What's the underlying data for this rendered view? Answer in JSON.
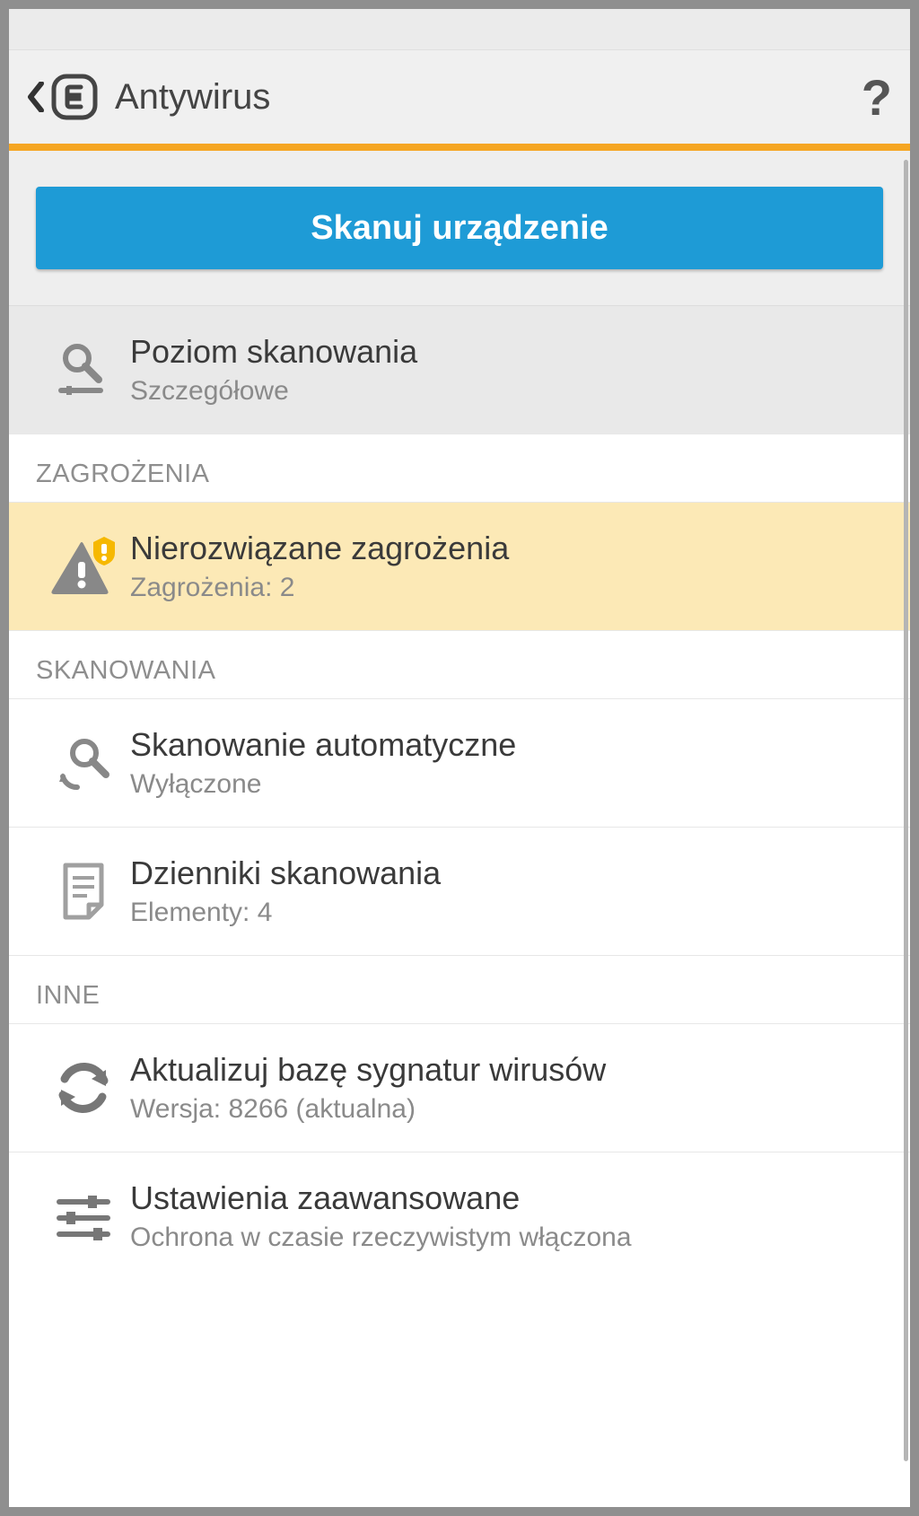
{
  "header": {
    "title": "Antywirus"
  },
  "scan_button": "Skanuj urządzenie",
  "scan_level": {
    "title": "Poziom skanowania",
    "value": "Szczegółowe"
  },
  "sections": {
    "threats": "ZAGROŻENIA",
    "scans": "SKANOWANIA",
    "other": "INNE"
  },
  "threats": {
    "title": "Nierozwiązane zagrożenia",
    "subtitle": "Zagrożenia: 2"
  },
  "auto_scan": {
    "title": "Skanowanie automatyczne",
    "subtitle": "Wyłączone"
  },
  "scan_logs": {
    "title": "Dzienniki skanowania",
    "subtitle": "Elementy: 4"
  },
  "update_db": {
    "title": "Aktualizuj bazę sygnatur wirusów",
    "subtitle": "Wersja: 8266 (aktualna)"
  },
  "advanced": {
    "title": "Ustawienia zaawansowane",
    "subtitle": "Ochrona w czasie rzeczywistym włączona"
  }
}
